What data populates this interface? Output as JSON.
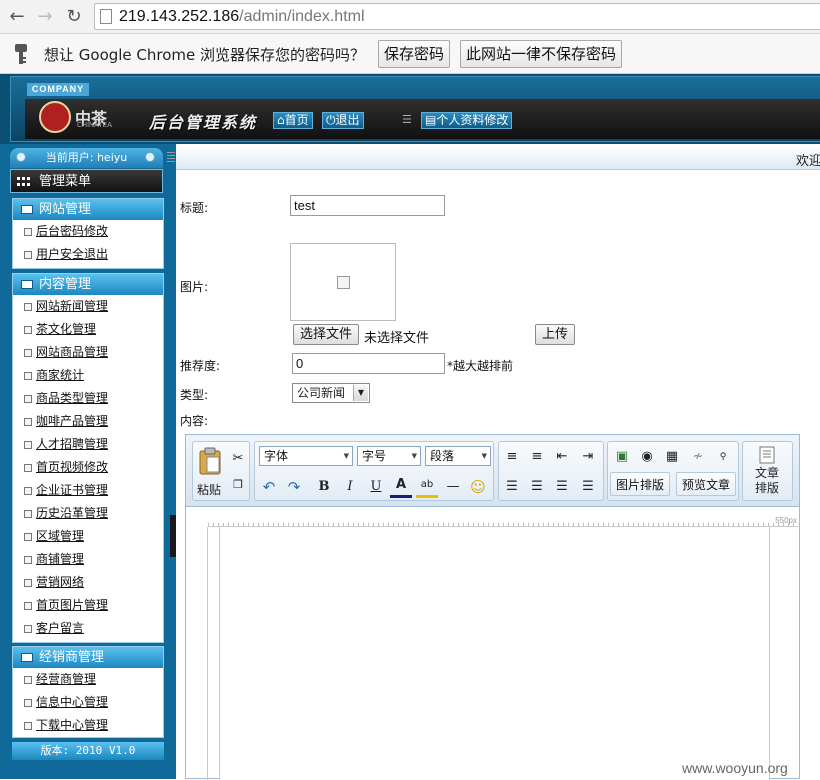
{
  "browser": {
    "url_host": "219.143.252.186",
    "url_path": "/admin/index.html",
    "password_prompt": "想让 Google Chrome 浏览器保存您的密码吗？",
    "save_password": "保存密码",
    "never_save": "此网站一律不保存密码"
  },
  "header": {
    "company": "COMPANY",
    "logo_text": "中茶",
    "logo_sub": "CHINATEA",
    "system_title": "后台管理系统",
    "nav_home": "首页",
    "nav_logout": "退出",
    "nav_profile": "个人资料修改"
  },
  "sidebar": {
    "current_user": "当前用户: heiyu",
    "menu_title": "管理菜单",
    "groups": [
      {
        "title": "网站管理",
        "items": [
          "后台密码修改",
          "用户安全退出"
        ]
      },
      {
        "title": "内容管理",
        "items": [
          "网站新闻管理",
          "茶文化管理",
          "网站商品管理",
          "商家统计",
          "商品类型管理",
          "咖啡产品管理",
          "人才招聘管理",
          "首页视频修改",
          "企业证书管理",
          "历史沿革管理",
          "区域管理",
          "商铺管理",
          "营销网络",
          "首页图片管理",
          "客户留言"
        ]
      },
      {
        "title": "经销商管理",
        "items": [
          "经营商管理",
          "信息中心管理",
          "下载中心管理"
        ]
      }
    ],
    "version": "版本: 2010 V1.0"
  },
  "main": {
    "welcome": "欢迎",
    "title_label": "标题:",
    "title_value": "test",
    "image_label": "图片:",
    "choose_file": "选择文件",
    "no_file": "未选择文件",
    "upload": "上传",
    "rank_label": "推荐度:",
    "rank_value": "0",
    "rank_hint": "*越大越排前",
    "type_label": "类型:",
    "type_value": "公司新闻",
    "content_label": "内容:"
  },
  "editor": {
    "paste": "粘贴",
    "font": "字体",
    "size": "字号",
    "paragraph": "段落",
    "image_layout": "图片排版",
    "preview": "预览文章",
    "article_layout_1": "文章",
    "article_layout_2": "排版",
    "ruler_px": "550px"
  },
  "watermark": "www.wooyun.org"
}
